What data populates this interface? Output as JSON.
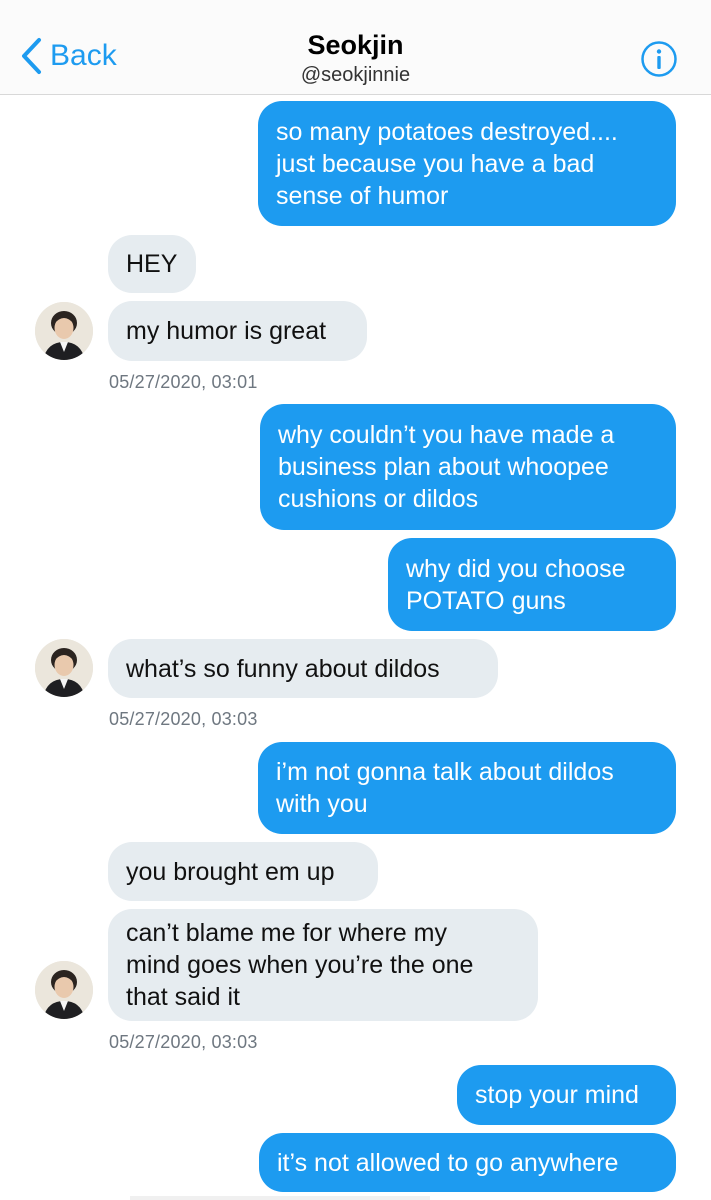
{
  "header": {
    "back_label": "Back",
    "title": "Seokjin",
    "handle": "@seokjinnie"
  },
  "colors": {
    "accent": "#1d9bf0",
    "received_bubble": "#e6ecf0"
  },
  "icons": {
    "back": "chevron-left-icon",
    "info": "info-icon"
  },
  "messages": [
    {
      "from": "me",
      "lines": [
        "so many potatoes destroyed....",
        "just because you have a bad",
        "sense of humor"
      ]
    },
    {
      "from": "them",
      "lines": [
        "HEY"
      ]
    },
    {
      "from": "them",
      "lines": [
        "my humor is great"
      ]
    },
    {
      "from": "me",
      "lines": [
        "why couldn’t you have made a",
        "business plan about whoopee",
        "cushions or dildos"
      ]
    },
    {
      "from": "me",
      "lines": [
        "why did you choose",
        "POTATO guns"
      ]
    },
    {
      "from": "them",
      "lines": [
        "what’s so funny about dildos"
      ]
    },
    {
      "from": "me",
      "lines": [
        "i’m not gonna talk about dildos",
        "with you"
      ]
    },
    {
      "from": "them",
      "lines": [
        "you brought em up"
      ]
    },
    {
      "from": "them",
      "lines": [
        "can’t blame me for where my",
        "mind goes when you’re the one",
        "that said it"
      ]
    },
    {
      "from": "me",
      "lines": [
        "stop your mind"
      ]
    },
    {
      "from": "me",
      "lines": [
        "it’s not allowed to go anywhere"
      ]
    }
  ],
  "timestamps": [
    "05/27/2020, 03:01",
    "05/27/2020, 03:03",
    "05/27/2020, 03:03"
  ]
}
